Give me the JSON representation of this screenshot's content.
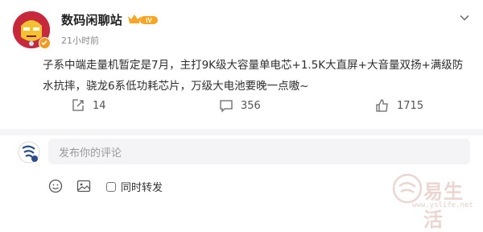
{
  "post": {
    "author": "数码闲聊站",
    "badge_level": "IV",
    "time": "21小时前",
    "content": "子系中端走量机暂定是7月，主打9K级大容量单电芯+1.5K大直屏+大音量双扬+满级防水抗摔，骁龙6系低功耗芯片，万级大电池要晚一点嗷~",
    "actions": {
      "share_count": "14",
      "comment_count": "356",
      "like_count": "1715"
    }
  },
  "comment": {
    "placeholder": "发布你的评论",
    "repost_label": "同时转发"
  },
  "watermark": {
    "text": "易生活",
    "url": "www.yslife.net"
  },
  "colors": {
    "avatar_red": "#c8283c",
    "verified_orange": "#f39a1e",
    "crown_gold": "#f6a623"
  },
  "icons": [
    "chevron-down-icon",
    "share-icon",
    "comment-icon",
    "like-icon",
    "emoji-icon",
    "image-icon",
    "crown-icon",
    "verified-icon"
  ]
}
